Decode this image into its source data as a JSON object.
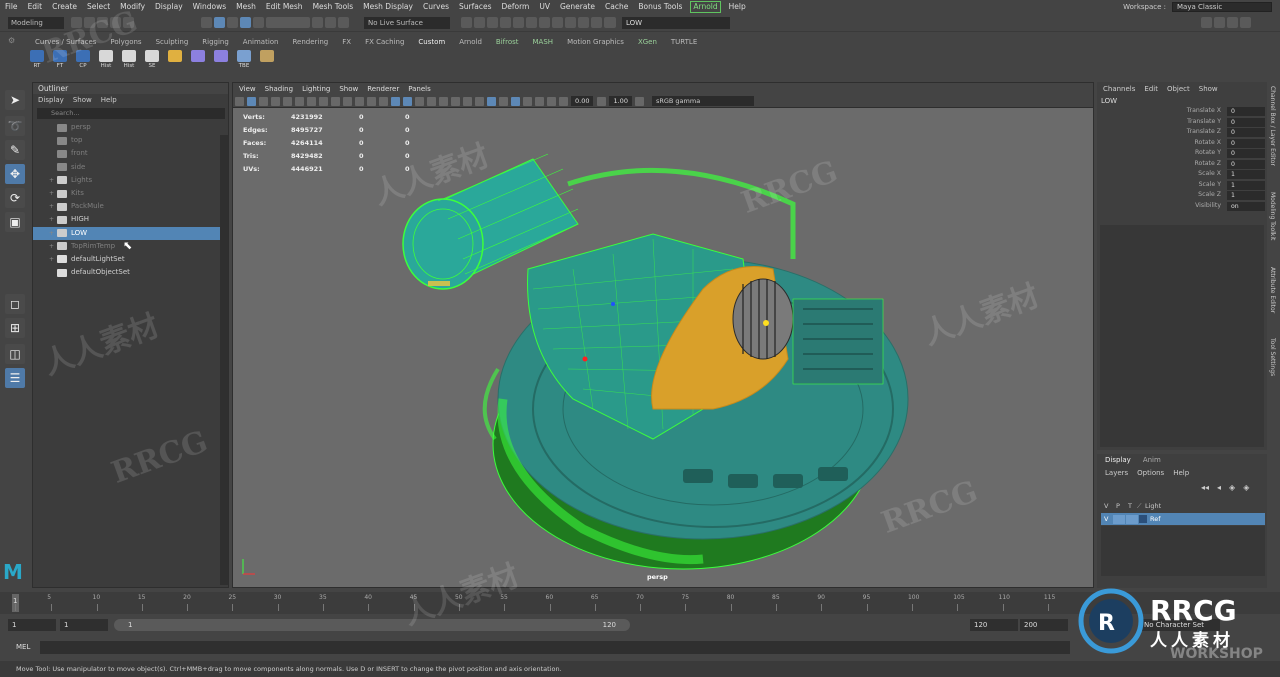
{
  "menubar": {
    "items": [
      "File",
      "Edit",
      "Create",
      "Select",
      "Modify",
      "Display",
      "Windows",
      "Mesh",
      "Edit Mesh",
      "Mesh Tools",
      "Mesh Display",
      "Curves",
      "Surfaces",
      "Deform",
      "UV",
      "Generate",
      "Cache",
      "Bonus Tools"
    ],
    "arnold": "Arnold",
    "help": "Help",
    "workspace_label": "Workspace :",
    "workspace_value": "Maya Classic"
  },
  "statusline": {
    "mode": "Modeling",
    "live_surface": "No Live Surface",
    "object_field": "LOW"
  },
  "shelf": {
    "tabs": [
      "Curves / Surfaces",
      "Polygons",
      "Sculpting",
      "Rigging",
      "Animation",
      "Rendering",
      "FX",
      "FX Caching",
      "Custom",
      "Arnold",
      "Bifrost",
      "MASH",
      "Motion Graphics",
      "XGen",
      "TURTLE"
    ],
    "icons": [
      {
        "label": "RT",
        "color": "#3c6fb5"
      },
      {
        "label": "FT",
        "color": "#3c6fb5"
      },
      {
        "label": "CP",
        "color": "#3c6fb5"
      },
      {
        "label": "Hist",
        "color": "#d8d8d8"
      },
      {
        "label": "Hist",
        "color": "#d8d8d8"
      },
      {
        "label": "SE",
        "color": "#d8d8d8"
      },
      {
        "label": "",
        "color": "#e0b040"
      },
      {
        "label": "",
        "color": "#8c80e0"
      },
      {
        "label": "",
        "color": "#8c80e0"
      },
      {
        "label": "TBE",
        "color": "#7aa0d0"
      },
      {
        "label": "",
        "color": "#c0a060"
      }
    ]
  },
  "outliner": {
    "title": "Outliner",
    "menu": [
      "Display",
      "Show",
      "Help"
    ],
    "search_placeholder": "Search...",
    "items": [
      {
        "label": "persp",
        "kind": "camera",
        "bright": false,
        "selected": false,
        "expand": ""
      },
      {
        "label": "top",
        "kind": "camera",
        "bright": false,
        "selected": false,
        "expand": ""
      },
      {
        "label": "front",
        "kind": "camera",
        "bright": false,
        "selected": false,
        "expand": ""
      },
      {
        "label": "side",
        "kind": "camera",
        "bright": false,
        "selected": false,
        "expand": ""
      },
      {
        "label": "Lights",
        "kind": "group",
        "bright": false,
        "selected": false,
        "expand": "+"
      },
      {
        "label": "Kits",
        "kind": "group",
        "bright": false,
        "selected": false,
        "expand": "+"
      },
      {
        "label": "PackMule",
        "kind": "group",
        "bright": false,
        "selected": false,
        "expand": "+"
      },
      {
        "label": "HIGH",
        "kind": "group",
        "bright": true,
        "selected": false,
        "expand": "+"
      },
      {
        "label": "LOW",
        "kind": "group",
        "bright": true,
        "selected": true,
        "expand": "+"
      },
      {
        "label": "TopRimTemp",
        "kind": "group",
        "bright": false,
        "selected": false,
        "expand": "+"
      },
      {
        "label": "defaultLightSet",
        "kind": "set",
        "bright": true,
        "selected": false,
        "expand": "+"
      },
      {
        "label": "defaultObjectSet",
        "kind": "set",
        "bright": true,
        "selected": false,
        "expand": ""
      }
    ]
  },
  "viewport": {
    "menu": [
      "View",
      "Shading",
      "Lighting",
      "Show",
      "Renderer",
      "Panels"
    ],
    "exposure": "0.00",
    "gamma": "1.00",
    "color_space": "sRGB gamma",
    "camera": "persp",
    "hud": [
      {
        "label": "Verts:",
        "v1": "4231992",
        "v2": "0",
        "v3": "0"
      },
      {
        "label": "Edges:",
        "v1": "8495727",
        "v2": "0",
        "v3": "0"
      },
      {
        "label": "Faces:",
        "v1": "4264114",
        "v2": "0",
        "v3": "0"
      },
      {
        "label": "Tris:",
        "v1": "8429482",
        "v2": "0",
        "v3": "0"
      },
      {
        "label": "UVs:",
        "v1": "4446921",
        "v2": "0",
        "v3": "0"
      }
    ]
  },
  "channelbox": {
    "menu": [
      "Channels",
      "Edit",
      "Object",
      "Show"
    ],
    "object": "LOW",
    "attrs": [
      {
        "name": "Translate X",
        "value": "0"
      },
      {
        "name": "Translate Y",
        "value": "0"
      },
      {
        "name": "Translate Z",
        "value": "0"
      },
      {
        "name": "Rotate X",
        "value": "0"
      },
      {
        "name": "Rotate Y",
        "value": "0"
      },
      {
        "name": "Rotate Z",
        "value": "0"
      },
      {
        "name": "Scale X",
        "value": "1"
      },
      {
        "name": "Scale Y",
        "value": "1"
      },
      {
        "name": "Scale Z",
        "value": "1"
      },
      {
        "name": "Visibility",
        "value": "on"
      }
    ]
  },
  "sidetabs": [
    "Channel Box / Layer Editor",
    "Modeling Toolkit",
    "Attribute Editor",
    "Tool Settings"
  ],
  "layer_editor": {
    "tabs": [
      "Display",
      "Anim"
    ],
    "menu": [
      "Layers",
      "Options",
      "Help"
    ],
    "header": {
      "v": "V",
      "p": "P",
      "t": "T",
      "name": "Light"
    },
    "row": {
      "v": "V",
      "name": "Ref"
    }
  },
  "timeslider": {
    "ticks": [
      "1",
      "5",
      "10",
      "15",
      "20",
      "25",
      "30",
      "35",
      "40",
      "45",
      "50",
      "55",
      "60",
      "65",
      "70",
      "75",
      "80",
      "85",
      "90",
      "95",
      "100",
      "105",
      "110",
      "115"
    ],
    "current": "1"
  },
  "range": {
    "start": "1",
    "start_inner": "1",
    "range_start": "1",
    "range_end": "120",
    "end_inner": "120",
    "end": "200",
    "no_char_set": "No Character Set"
  },
  "mel": {
    "label": "MEL"
  },
  "helpline": "Move Tool: Use manipulator to move object(s). Ctrl+MMB+drag to move components along normals. Use D or INSERT to change the pivot position and axis orientation.",
  "watermark": {
    "text_a": "RRCG",
    "text_b": "人人素材",
    "logo_big": "RRCG",
    "logo_cn": "人人素材",
    "logo_ws": "WORKSHOP"
  }
}
